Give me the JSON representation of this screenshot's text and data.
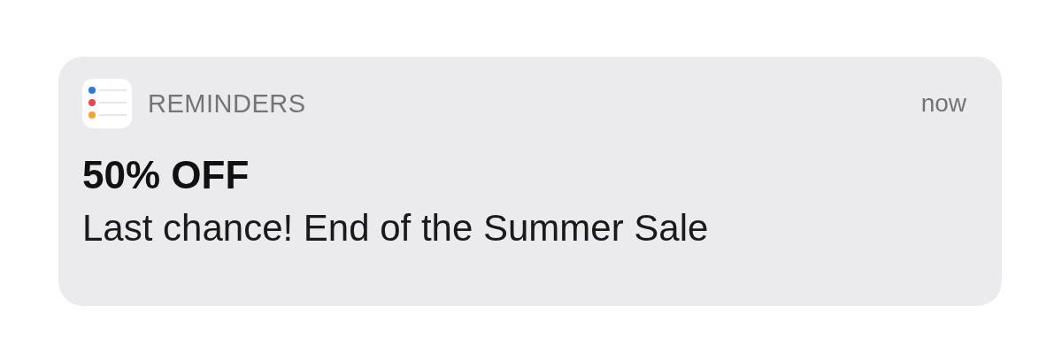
{
  "notification": {
    "app_name": "REMINDERS",
    "time": "now",
    "title": "50% OFF",
    "body": "Last chance! End of the Summer Sale"
  }
}
